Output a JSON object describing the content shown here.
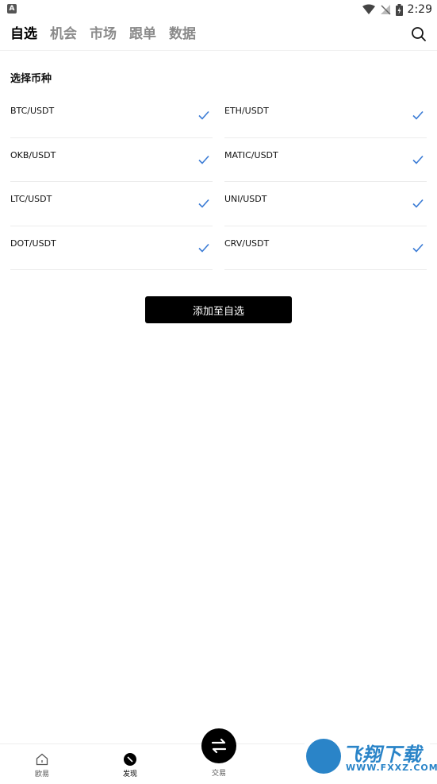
{
  "status_bar": {
    "time": "2:29",
    "app_icon": "A"
  },
  "nav": {
    "tabs": [
      {
        "label": "自选",
        "active": true
      },
      {
        "label": "机会",
        "active": false
      },
      {
        "label": "市场",
        "active": false
      },
      {
        "label": "跟单",
        "active": false
      },
      {
        "label": "数据",
        "active": false
      }
    ],
    "search_icon": "search-icon"
  },
  "section": {
    "title": "选择币种"
  },
  "coins": [
    {
      "label": "BTC/USDT",
      "checked": true
    },
    {
      "label": "ETH/USDT",
      "checked": true
    },
    {
      "label": "OKB/USDT",
      "checked": true
    },
    {
      "label": "MATIC/USDT",
      "checked": true
    },
    {
      "label": "LTC/USDT",
      "checked": true
    },
    {
      "label": "UNI/USDT",
      "checked": true
    },
    {
      "label": "DOT/USDT",
      "checked": true
    },
    {
      "label": "CRV/USDT",
      "checked": true
    }
  ],
  "add_button": {
    "label": "添加至自选"
  },
  "bottom_nav": {
    "items": [
      {
        "label": "欧易"
      },
      {
        "label": "发现"
      },
      {
        "label": "交易"
      }
    ]
  },
  "watermark": {
    "text": "飞翔下载",
    "sub": "WWW.FXXZ.COM"
  },
  "colors": {
    "accent": "#3a7bd5",
    "button_bg": "#000000",
    "tab_inactive": "#8a8a8a",
    "watermark": "#2a84c8"
  }
}
